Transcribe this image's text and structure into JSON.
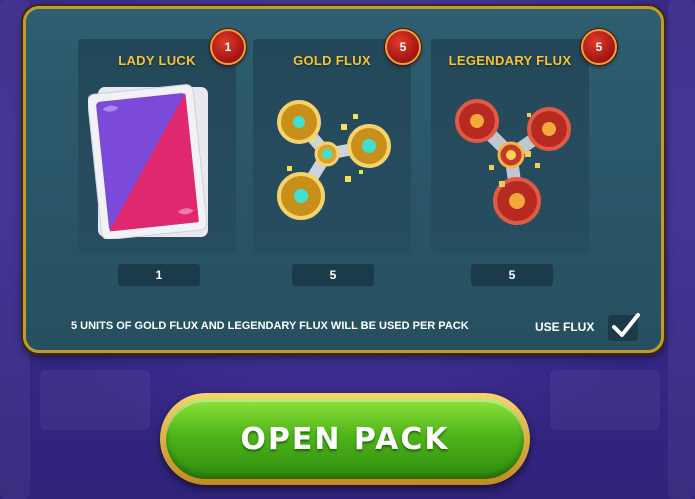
{
  "items": [
    {
      "title": "LADY LUCK",
      "badge": "1",
      "quantity": "1"
    },
    {
      "title": "GOLD FLUX",
      "badge": "5",
      "quantity": "5"
    },
    {
      "title": "LEGENDARY FLUX",
      "badge": "5",
      "quantity": "5"
    }
  ],
  "info_text": "5 UNITS OF GOLD FLUX AND LEGENDARY FLUX WILL BE USED PER PACK",
  "use_flux": {
    "label": "USE FLUX",
    "checked": true
  },
  "open_button": {
    "label": "OPEN PACK"
  },
  "colors": {
    "accent_gold": "#f4c534",
    "button_green": "#4fb51a",
    "badge_red": "#c41e12"
  },
  "icons": [
    "card-deck-icon",
    "gold-spinner-icon",
    "legendary-spinner-icon",
    "checkmark-icon"
  ]
}
